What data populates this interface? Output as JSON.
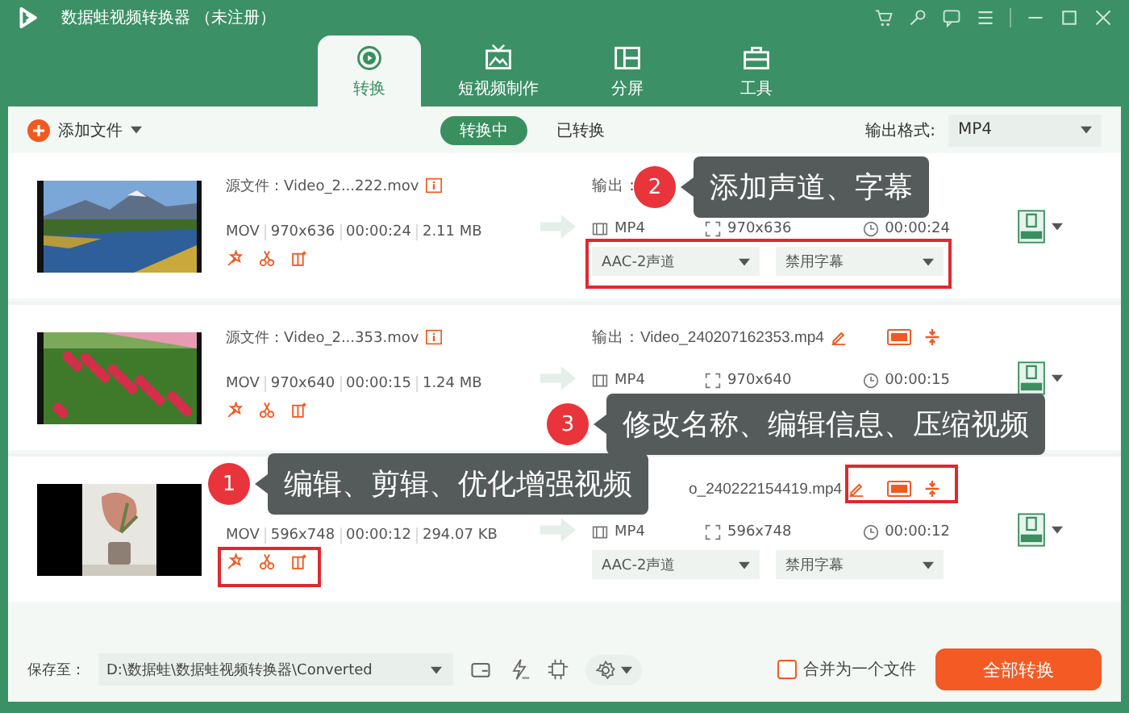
{
  "window": {
    "title": "数据蛙视频转换器 （未注册）"
  },
  "tabs": [
    {
      "label": "转换",
      "selected": true
    },
    {
      "label": "短视频制作",
      "selected": false
    },
    {
      "label": "分屏",
      "selected": false
    },
    {
      "label": "工具",
      "selected": false
    }
  ],
  "toolbar": {
    "add_file": "添加文件",
    "segments": [
      {
        "label": "转换中",
        "selected": true
      },
      {
        "label": "已转换",
        "selected": false
      }
    ],
    "format_label": "输出格式:",
    "format_value": "MP4"
  },
  "files": [
    {
      "source": "源文件：Video_2...222.mov",
      "meta": [
        "MOV",
        "970x636",
        "00:00:24",
        "2.11 MB"
      ],
      "output": "输出：",
      "output_tools": false,
      "format": "MP4",
      "resolution": "970x636",
      "duration": "00:00:24",
      "audio": "AAC-2声道",
      "subtitle": "禁用字幕"
    },
    {
      "source": "源文件：Video_2...353.mov",
      "meta": [
        "MOV",
        "970x640",
        "00:00:15",
        "1.24 MB"
      ],
      "output": "输出：Video_240207162353.mp4",
      "output_tools": true,
      "format": "MP4",
      "resolution": "970x640",
      "duration": "00:00:15"
    },
    {
      "meta": [
        "MOV",
        "596x748",
        "00:00:12",
        "294.07 KB"
      ],
      "output": "o_240222154419.mp4",
      "output_tools": true,
      "format": "MP4",
      "resolution": "596x748",
      "duration": "00:00:12",
      "audio": "AAC-2声道",
      "subtitle": "禁用字幕"
    }
  ],
  "callouts": [
    {
      "number": "1",
      "text": "编辑、剪辑、优化增强视频"
    },
    {
      "number": "2",
      "text": "添加声道、字幕"
    },
    {
      "number": "3",
      "text": "修改名称、编辑信息、压缩视频"
    }
  ],
  "bottom": {
    "save_label": "保存至：",
    "path": "D:\\数据蛙\\数据蛙视频转换器\\Converted",
    "merge": {
      "label": "合并为一个文件",
      "checked": false
    },
    "convert_all": "全部转换"
  }
}
